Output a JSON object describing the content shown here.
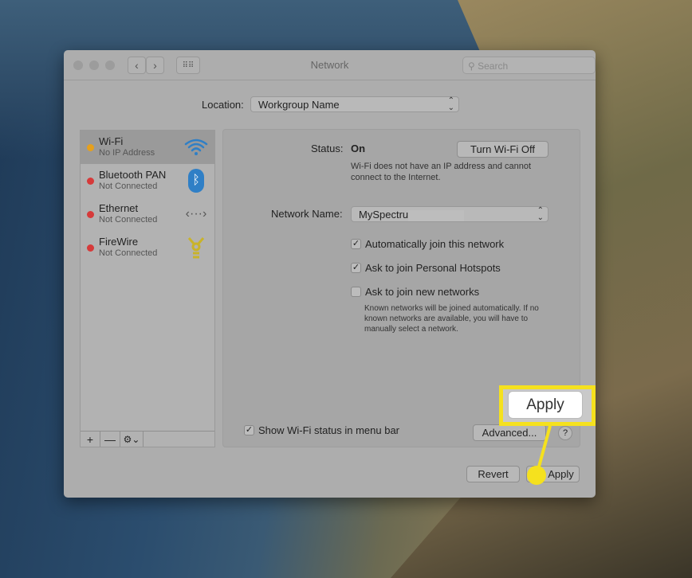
{
  "window": {
    "title": "Network",
    "search_placeholder": "Search",
    "back": "‹",
    "forward": "›"
  },
  "location": {
    "label": "Location:",
    "value": "Workgroup Name"
  },
  "services": [
    {
      "name": "Wi-Fi",
      "status": "No IP Address",
      "dot_color": "#e6a01c",
      "icon": "wifi-icon",
      "selected": true
    },
    {
      "name": "Bluetooth PAN",
      "status": "Not Connected",
      "dot_color": "#d63a3a",
      "icon": "bluetooth-icon"
    },
    {
      "name": "Ethernet",
      "status": "Not Connected",
      "dot_color": "#d63a3a",
      "icon": "ethernet-icon"
    },
    {
      "name": "FireWire",
      "status": "Not Connected",
      "dot_color": "#d63a3a",
      "icon": "firewire-icon"
    }
  ],
  "sidebar_toolbar": {
    "add": "+",
    "remove": "—",
    "gear": "⚙⌄"
  },
  "detail": {
    "status_label": "Status:",
    "status_value": "On",
    "turn_off_button": "Turn Wi-Fi Off",
    "status_desc": "Wi-Fi does not have an IP address and cannot connect to the Internet.",
    "network_name_label": "Network Name:",
    "network_name_value": "MySpectru",
    "options": [
      {
        "label": "Automatically join this network",
        "checked": true
      },
      {
        "label": "Ask to join Personal Hotspots",
        "checked": true
      },
      {
        "label": "Ask to join new networks",
        "checked": false
      }
    ],
    "options_note": "Known networks will be joined automatically. If no known networks are available, you will have to manually select a network.",
    "show_status": {
      "label": "Show Wi-Fi status in menu bar",
      "checked": true
    },
    "advanced_button": "Advanced...",
    "help": "?"
  },
  "footer": {
    "revert": "Revert",
    "apply": "Apply"
  },
  "callout": {
    "label": "Apply",
    "color": "#f5e11e"
  }
}
